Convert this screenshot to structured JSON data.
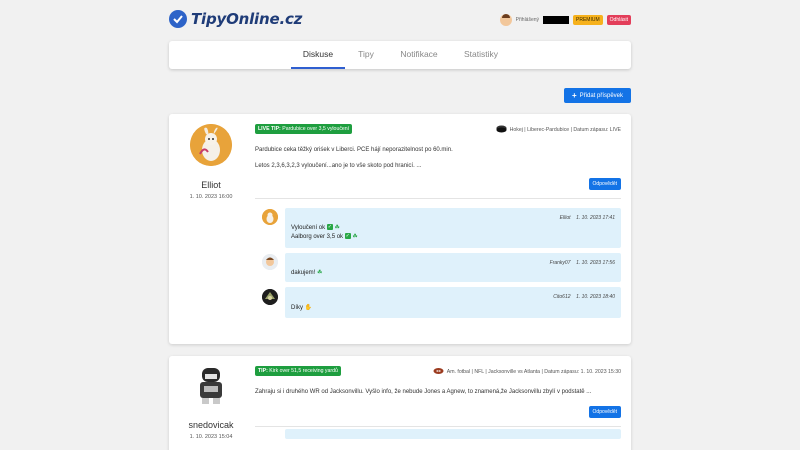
{
  "header": {
    "logo_text": "TipyOnline.cz",
    "login_label": "Přihlášený",
    "premium_label": "PREMIUM",
    "logout_label": "Odhlásit"
  },
  "tabs": [
    {
      "label": "Diskuse",
      "active": true
    },
    {
      "label": "Tipy",
      "active": false
    },
    {
      "label": "Notifikace",
      "active": false
    },
    {
      "label": "Statistiky",
      "active": false
    }
  ],
  "add_post_label": "Přidat příspěvek",
  "posts": [
    {
      "author": "Elliot",
      "date": "1. 10. 2023 16:00",
      "tip_prefix": "LIVE TIP:",
      "tip_text": "Pardubice over 3,5 vyloučení",
      "meta": "Hokej | Liberec-Pardubice | Datum zápasu: LIVE",
      "meta_icon": "hockey-puck-icon",
      "text_lines": [
        "Pardubice ceka těžký oriśek v Liberci. PCE hájí neporazitelnost po 60.min.",
        "Letos 2,3,6,3,2,3 vyloučení...ano je to vše skoto pod hranicí. ..."
      ],
      "reply_label": "Odpovědět",
      "comments": [
        {
          "author": "Elliot",
          "date": "1. 10. 2023 17:41",
          "lines": [
            "Vyloučení ok",
            "Aalborg over 3,5 ok"
          ]
        },
        {
          "author": "Franky07",
          "date": "1. 10. 2023 17:56",
          "lines": [
            "dakujem!"
          ]
        },
        {
          "author": "Cito612",
          "date": "1. 10. 2023 18:40",
          "lines": [
            "Díky"
          ]
        }
      ]
    },
    {
      "author": "snedovicak",
      "date": "1. 10. 2023 15:04",
      "tip_prefix": "TIP:",
      "tip_text": "Kirk over 51,5 receiving yardů",
      "meta": "Am. fotbal | NFL | Jacksonville vs Atlanta | Datum zápasu: 1. 10. 2023 15:30",
      "meta_icon": "american-football-icon",
      "text_lines": [
        "Zahraju si i druhého WR od Jacksonvillu. Vyšlo info, že nebude Jones a Agnew, to znamená,že Jacksonvillu zbylí v podstatě ..."
      ],
      "reply_label": "Odpovědět"
    }
  ],
  "colors": {
    "accent": "#1373e6",
    "tab_underline": "#2f5fd0",
    "tip_green": "#1e9e3f",
    "comment_bg": "#dff1fb",
    "premium": "#f6b11c",
    "logout": "#e33e5a"
  }
}
